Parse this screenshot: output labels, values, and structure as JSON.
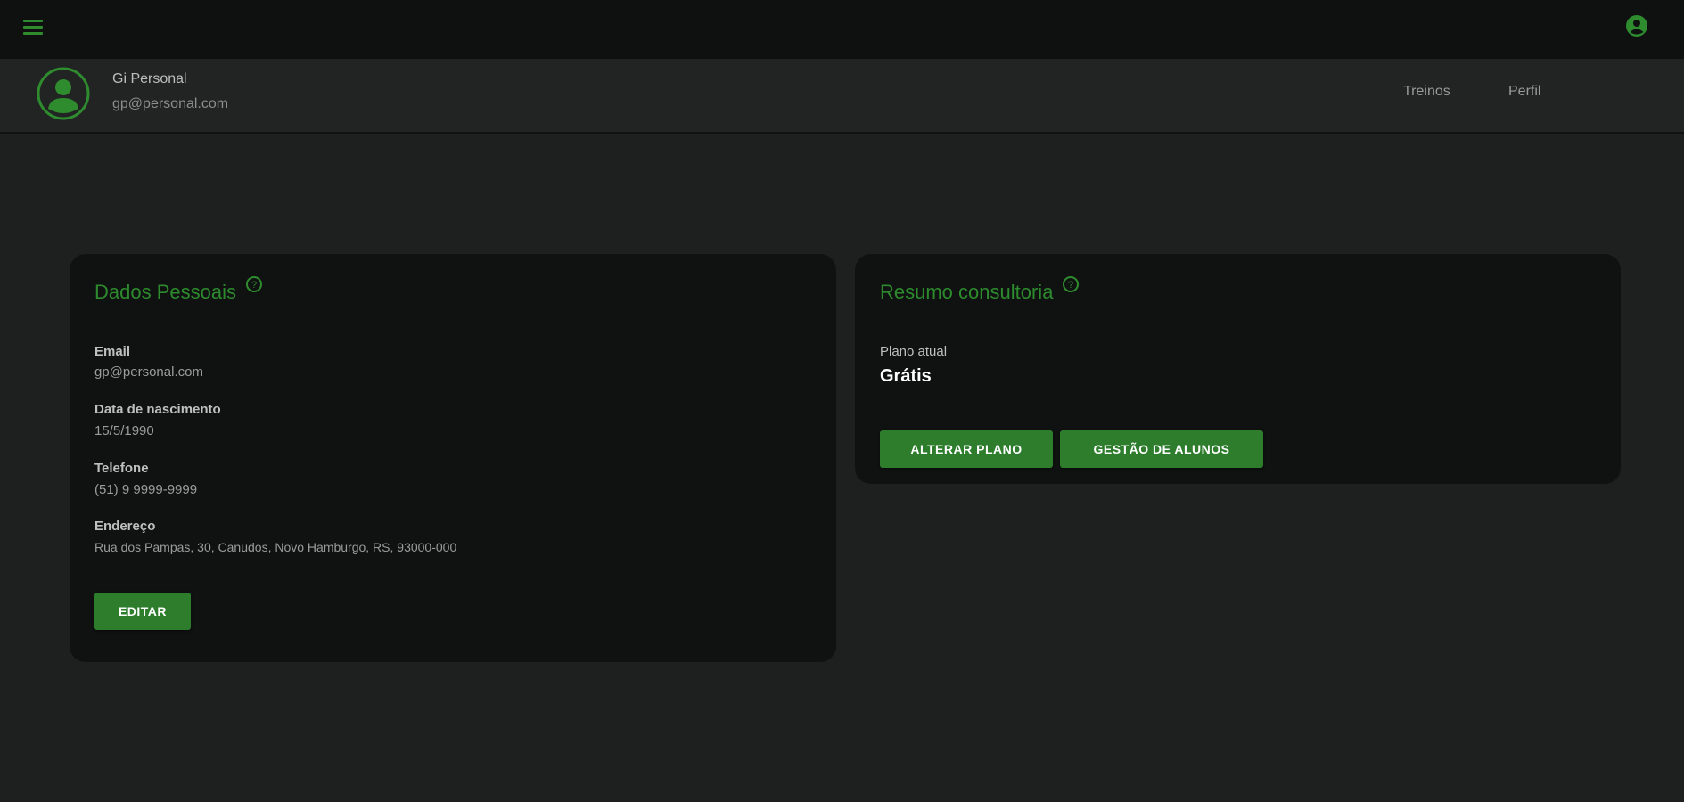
{
  "topbar": {
    "menu_icon": "hamburger-menu-icon",
    "account_icon": "account-circle-icon",
    "accent_color": "#2e8b2e"
  },
  "user": {
    "name": "Gi Personal",
    "email": "gp@personal.com"
  },
  "nav": {
    "items": [
      {
        "label": "Treinos"
      },
      {
        "label": "Perfil"
      }
    ]
  },
  "personal_card": {
    "title": "Dados Pessoais",
    "fields": [
      {
        "label": "Email",
        "value": "gp@personal.com"
      },
      {
        "label": "Data de nascimento",
        "value": "15/5/1990"
      },
      {
        "label": "Telefone",
        "value": "(51) 9 9999-9999"
      },
      {
        "label": "Endereço",
        "value": "Rua dos Pampas, 30, Canudos, Novo Hamburgo, RS, 93000-000"
      }
    ],
    "edit_label": "EDITAR"
  },
  "consulting_card": {
    "title": "Resumo consultoria",
    "plan_label": "Plano atual",
    "plan_value": "Grátis",
    "change_plan_label": "ALTERAR PLANO",
    "students_label": "GESTÃO DE ALUNOS"
  }
}
